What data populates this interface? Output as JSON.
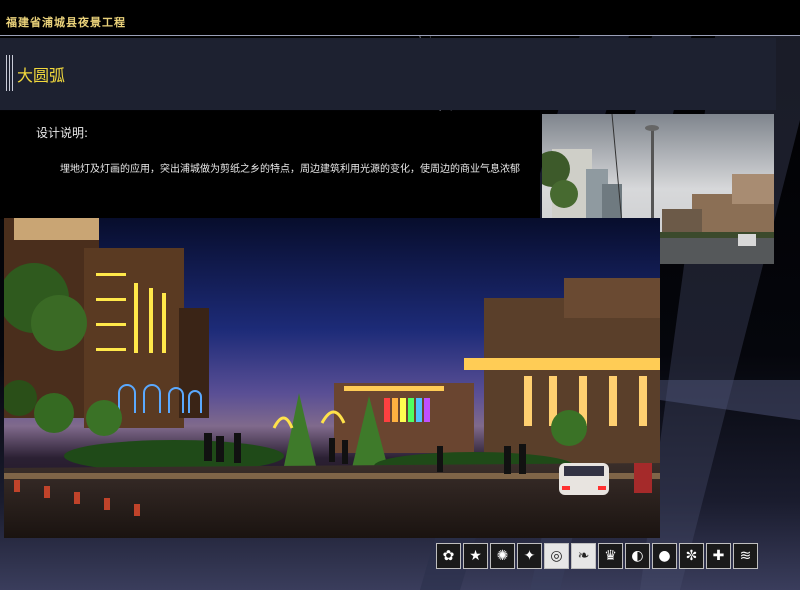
{
  "header": {
    "title": "福建省浦城县夜景工程"
  },
  "section": {
    "title": "大圆弧"
  },
  "description": {
    "heading": "设计说明:",
    "text": "埋地灯及灯画的应用，突出浦城做为剪纸之乡的特点，周边建筑利用光源的变化，使周边的商业气息浓郁"
  },
  "images": {
    "day_photo": "daytime street photo of the site",
    "night_render": "night lighting rendering of the plaza"
  },
  "colors": {
    "title_gold": "#f2d93c",
    "header_gold": "#e9d17a",
    "band": "#1d2130"
  },
  "icon_strip": [
    {
      "icon": "flower-icon",
      "glyph": "✿"
    },
    {
      "icon": "star-icon",
      "glyph": "★"
    },
    {
      "icon": "sunburst-icon",
      "glyph": "✺"
    },
    {
      "icon": "sparkle-icon",
      "glyph": "✦"
    },
    {
      "icon": "ring-icon",
      "glyph": "◎"
    },
    {
      "icon": "leaf-icon",
      "glyph": "❧"
    },
    {
      "icon": "crown-icon",
      "glyph": "♛"
    },
    {
      "icon": "half-moon-icon",
      "glyph": "◐"
    },
    {
      "icon": "drop-icon",
      "glyph": "●"
    },
    {
      "icon": "cluster-icon",
      "glyph": "✼"
    },
    {
      "icon": "cross-icon",
      "glyph": "✚"
    },
    {
      "icon": "wave-icon",
      "glyph": "≋"
    }
  ]
}
